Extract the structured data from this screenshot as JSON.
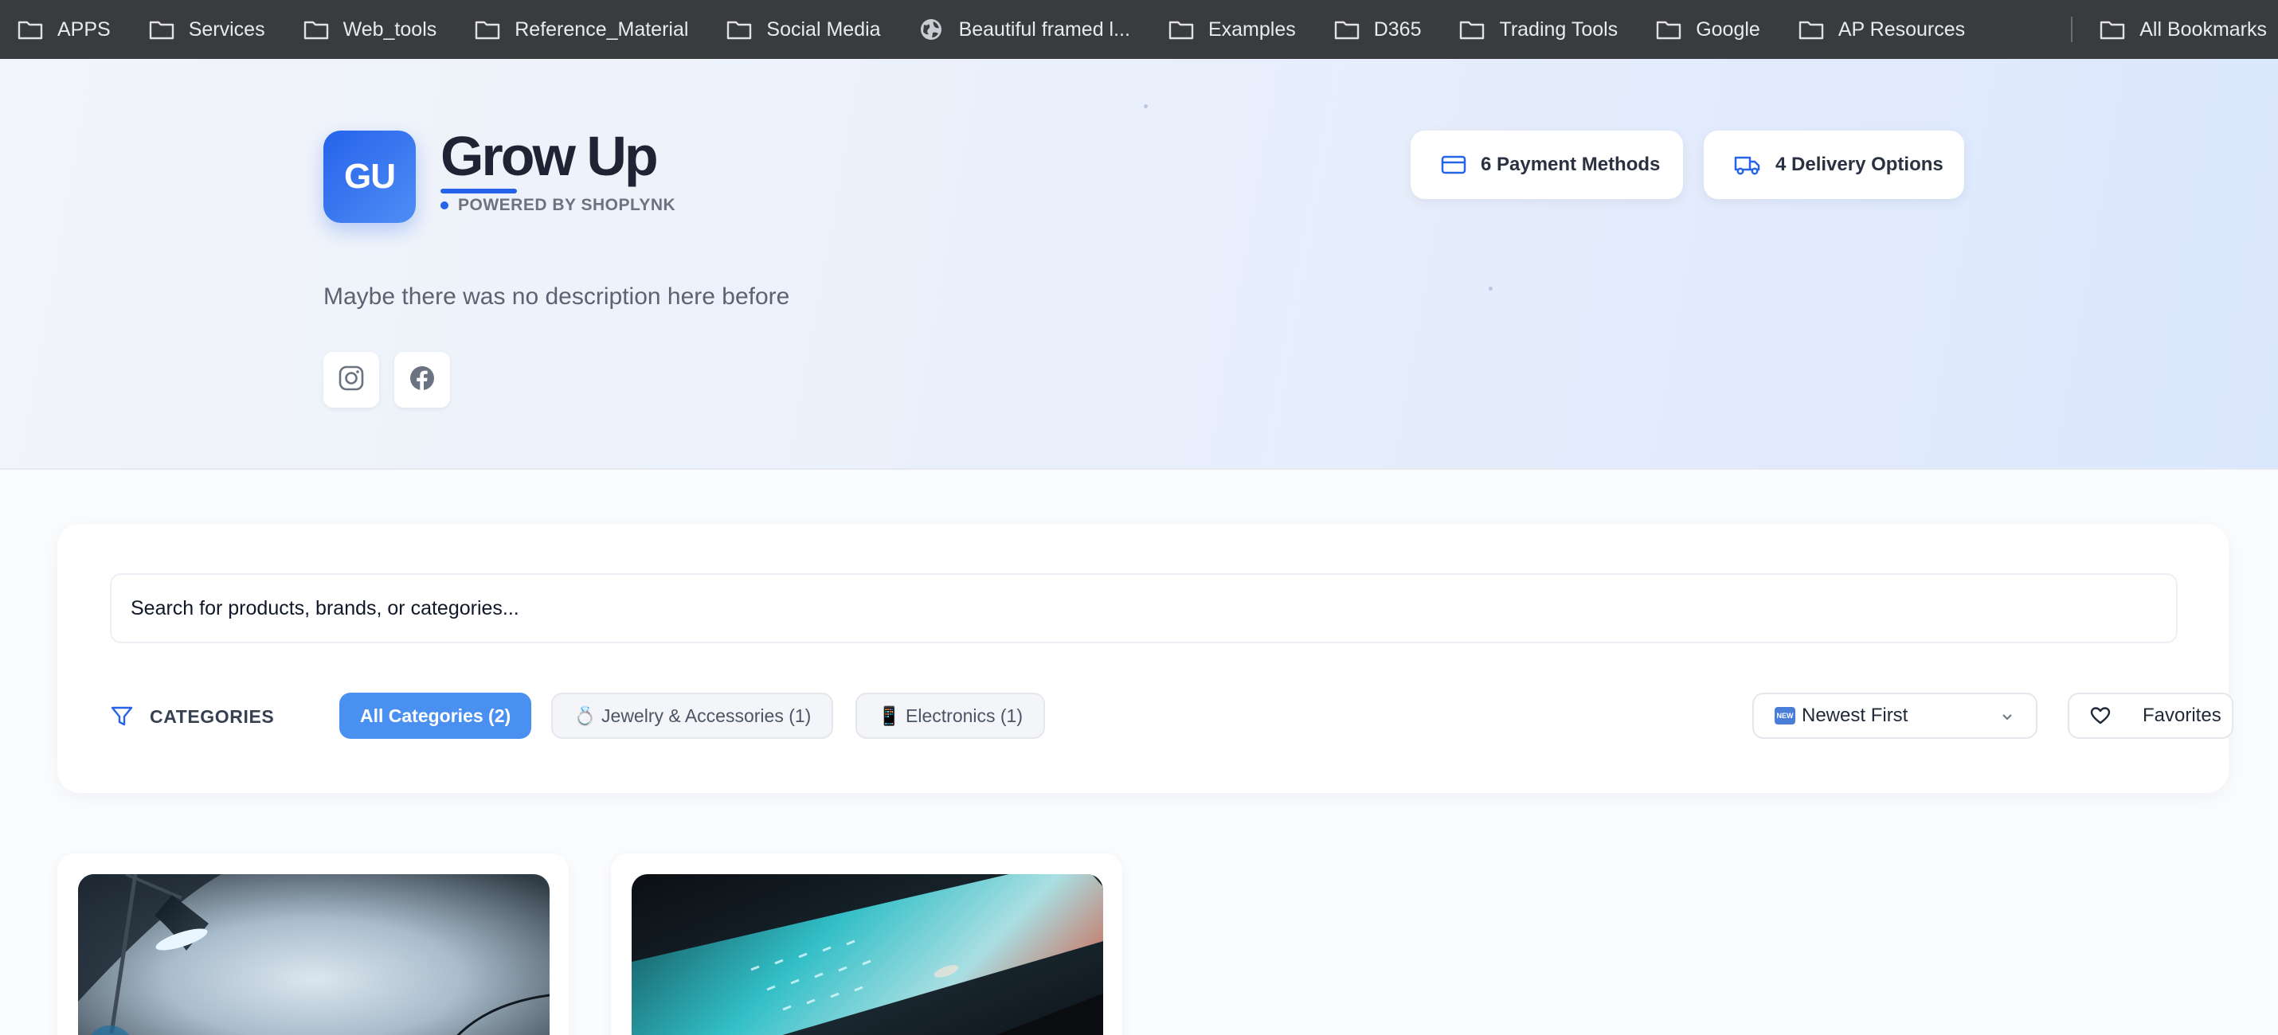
{
  "bookmarks": {
    "items": [
      {
        "label": "APPS",
        "icon": "folder-icon"
      },
      {
        "label": "Services",
        "icon": "folder-icon"
      },
      {
        "label": "Web_tools",
        "icon": "folder-icon"
      },
      {
        "label": "Reference_Material",
        "icon": "folder-icon"
      },
      {
        "label": "Social Media",
        "icon": "folder-icon"
      },
      {
        "label": "Beautiful framed l...",
        "icon": "globe-icon"
      },
      {
        "label": "Examples",
        "icon": "folder-icon"
      },
      {
        "label": "D365",
        "icon": "folder-icon"
      },
      {
        "label": "Trading Tools",
        "icon": "folder-icon"
      },
      {
        "label": "Google",
        "icon": "folder-icon"
      },
      {
        "label": "AP Resources",
        "icon": "folder-icon"
      }
    ],
    "all_bookmarks": "All Bookmarks"
  },
  "store": {
    "initials": "GU",
    "name": "Grow Up",
    "powered_by": "POWERED BY SHOPLYNK",
    "description": "Maybe there was no description here before",
    "social": [
      "instagram-icon",
      "facebook-icon"
    ],
    "payment_methods": "6 Payment Methods",
    "delivery_options": "4 Delivery Options",
    "accent_color": "#2563eb"
  },
  "search": {
    "placeholder": "Search for products, brands, or categories..."
  },
  "filters": {
    "categories_label": "CATEGORIES",
    "chips": [
      {
        "label": "All Categories (2)",
        "active": true
      },
      {
        "label": "💍 Jewelry & Accessories (1)",
        "active": false
      },
      {
        "label": "📱 Electronics (1)",
        "active": false
      }
    ],
    "sort": {
      "badge": "NEW",
      "selected": "Newest First"
    },
    "favorites_label": "Favorites",
    "active_chip_color": "#4a90f0"
  },
  "products": [
    {
      "image": "desk lamp photo"
    },
    {
      "image": "keyboard photo"
    }
  ]
}
